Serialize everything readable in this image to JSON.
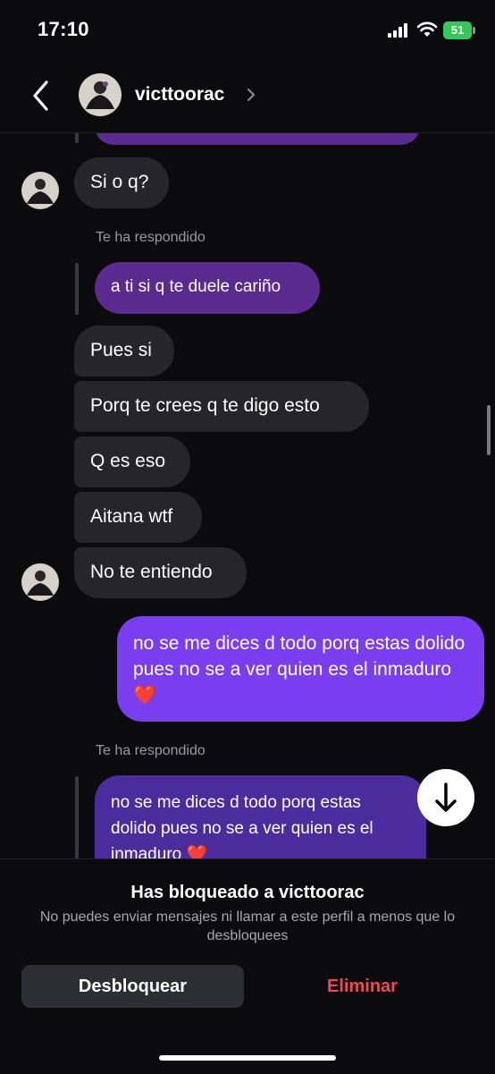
{
  "status": {
    "time": "17:10",
    "battery": "51"
  },
  "header": {
    "username": "victtoorac"
  },
  "colors": {
    "purple_dim": "#5a2a8f",
    "purple_bright": "#7a3df0",
    "gray_bubble": "#262629",
    "delete_red": "#ed4956"
  },
  "messages": {
    "m1": "Si o q?",
    "reply_label_1": "Te ha respondido",
    "quoted_1": "a ti si q te duele cariño",
    "m2": "Pues si",
    "m3": "Porq te crees q te digo esto",
    "m4": "Q es eso",
    "m5": "Aitana wtf",
    "m6": "No te entiendo",
    "sent": "no se me dices d todo porq estas dolido pues no se a ver quien es el inmaduro ❤️",
    "reply_label_2": "Te ha respondido",
    "quoted_2": "no se me dices d todo porq estas dolido pues no se a ver quien es el inmaduro ❤️"
  },
  "blocked": {
    "title": "Has bloqueado a victtoorac",
    "subtitle": "No puedes enviar mensajes ni llamar a este perfil a menos que lo desbloquees",
    "unblock_label": "Desbloquear",
    "delete_label": "Eliminar"
  },
  "icons": [
    "back-arrow-icon",
    "chevron-right-icon",
    "signal-icon",
    "wifi-icon",
    "battery-icon",
    "scroll-down-arrow-icon"
  ]
}
